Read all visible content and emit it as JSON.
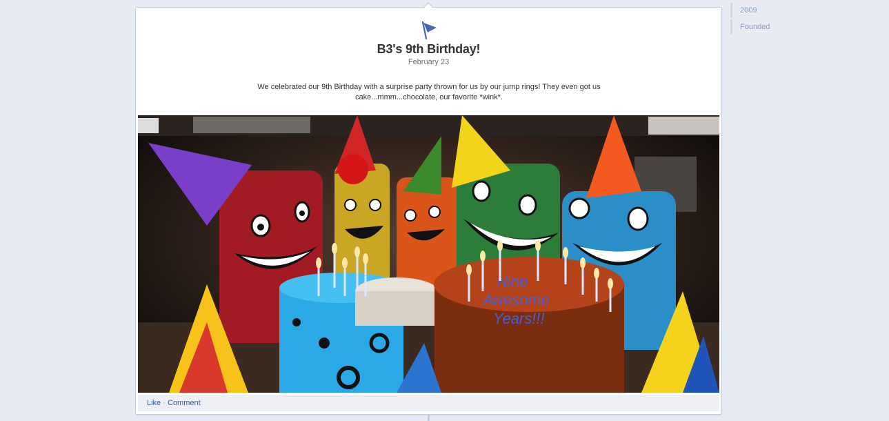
{
  "timeline_nav": {
    "items": [
      {
        "label": "2009"
      },
      {
        "label": "Founded"
      }
    ]
  },
  "story": {
    "title": "B3's 9th Birthday!",
    "date": "February 23",
    "text": "We celebrated our 9th Birthday with a surprise party thrown for us by our jump rings! They even got us cake...mmm...chocolate, our favorite *wink*.",
    "icon": "flag-icon"
  },
  "actions": {
    "like": "Like",
    "separator": "·",
    "comment": "Comment"
  },
  "colors": {
    "link": "#3b5998",
    "accent": "#4a67ad",
    "page_bg": "#e9ebf2"
  }
}
